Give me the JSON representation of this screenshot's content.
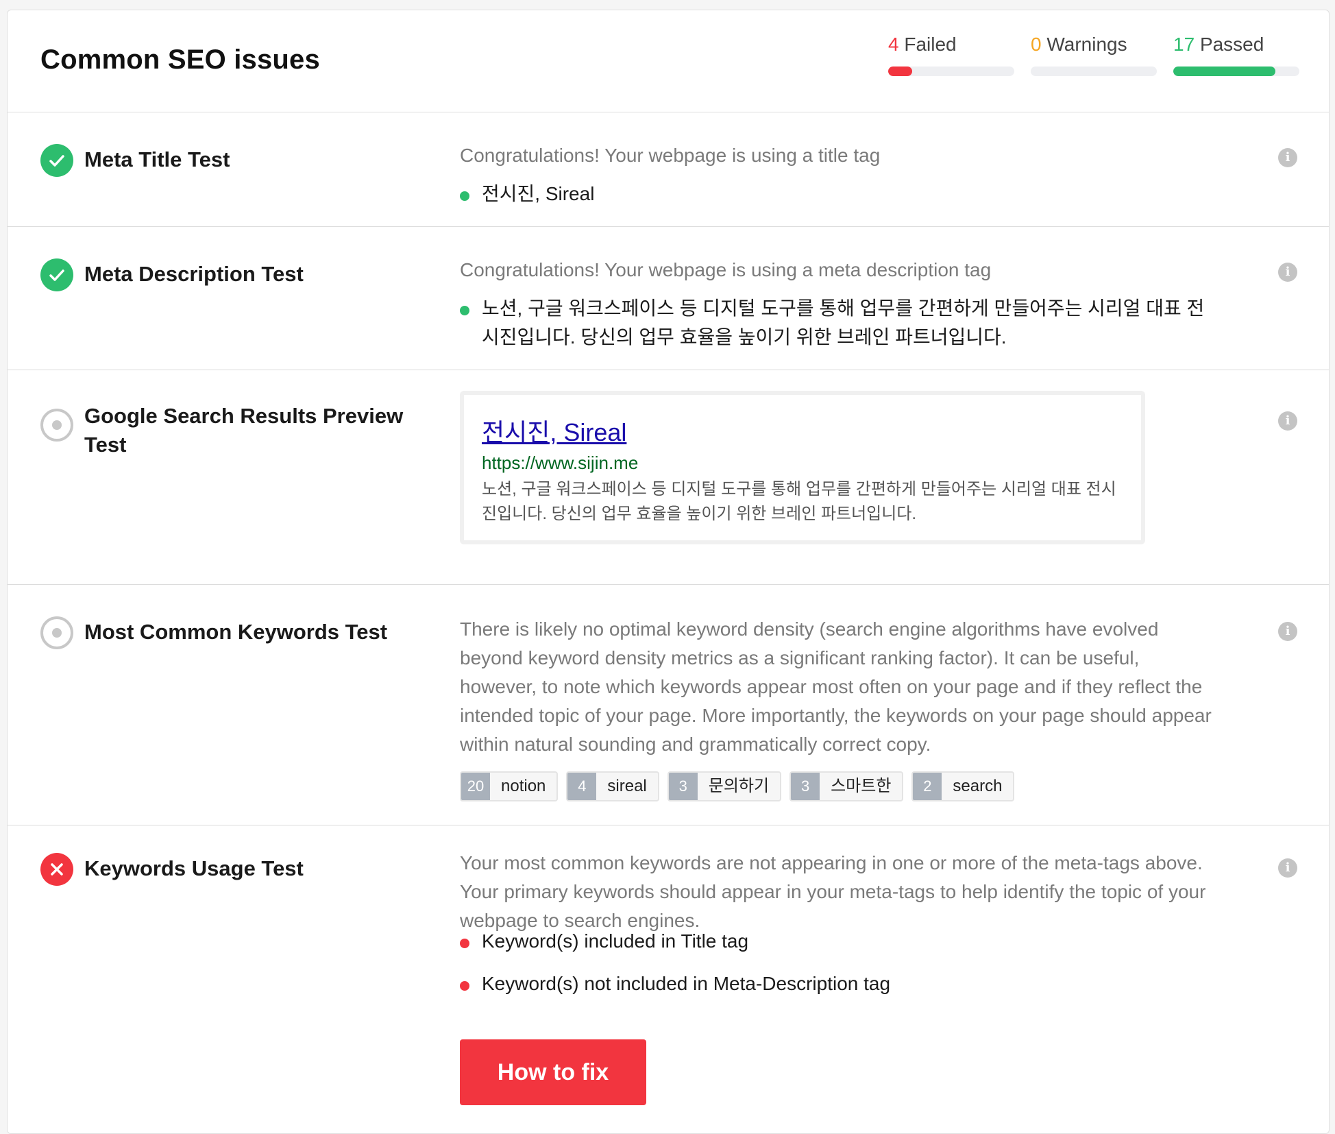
{
  "header": {
    "title": "Common SEO issues",
    "stats": [
      {
        "count": "4",
        "label": "Failed",
        "color": "#f2353f",
        "progress": 0.19
      },
      {
        "count": "0",
        "label": "Warnings",
        "color": "#f5a623",
        "progress": 0.0
      },
      {
        "count": "17",
        "label": "Passed",
        "color": "#2dbd6e",
        "progress": 0.81
      }
    ]
  },
  "tests": {
    "meta_title": {
      "name": "Meta Title Test",
      "status": "passed",
      "message": "Congratulations! Your webpage is using a title tag",
      "value": "전시진, Sireal"
    },
    "meta_description": {
      "name": "Meta Description Test",
      "status": "passed",
      "message": "Congratulations! Your webpage is using a meta description tag",
      "value": "노션, 구글 워크스페이스 등 디지털 도구를 통해 업무를 간편하게 만들어주는 시리얼 대표 전시진입니다. 당신의 업무 효율을 높이기 위한 브레인 파트너입니다."
    },
    "serp_preview": {
      "name": "Google Search Results Preview Test",
      "status": "info",
      "title": "전시진, Sireal",
      "url": "https://www.sijin.me",
      "description": "노션, 구글 워크스페이스 등 디지털 도구를 통해 업무를 간편하게 만들어주는 시리얼 대표 전시진입니다. 당신의 업무 효율을 높이기 위한 브레인 파트너입니다."
    },
    "keywords": {
      "name": "Most Common Keywords Test",
      "status": "info",
      "message": "There is likely no optimal keyword density (search engine algorithms have evolved beyond keyword density metrics as a significant ranking factor). It can be useful, however, to note which keywords appear most often on your page and if they reflect the intended topic of your page. More importantly, the keywords on your page should appear within natural sounding and grammatically correct copy.",
      "items": [
        {
          "count": "20",
          "word": "notion"
        },
        {
          "count": "4",
          "word": "sireal"
        },
        {
          "count": "3",
          "word": "문의하기"
        },
        {
          "count": "3",
          "word": "스마트한"
        },
        {
          "count": "2",
          "word": "search"
        }
      ]
    },
    "keywords_usage": {
      "name": "Keywords Usage Test",
      "status": "failed",
      "message": "Your most common keywords are not appearing in one or more of the meta-tags above. Your primary keywords should appear in your meta-tags to help identify the topic of your webpage to search engines.",
      "bullets": [
        "Keyword(s) included in Title tag",
        "Keyword(s) not included in Meta-Description tag"
      ],
      "fix_label": "How to fix"
    }
  },
  "info_glyph": "i",
  "colors": {
    "pass": "#2dbd6e",
    "fail": "#f2353f",
    "warn": "#f5a623",
    "link": "#1a0dab",
    "url": "#006621"
  }
}
